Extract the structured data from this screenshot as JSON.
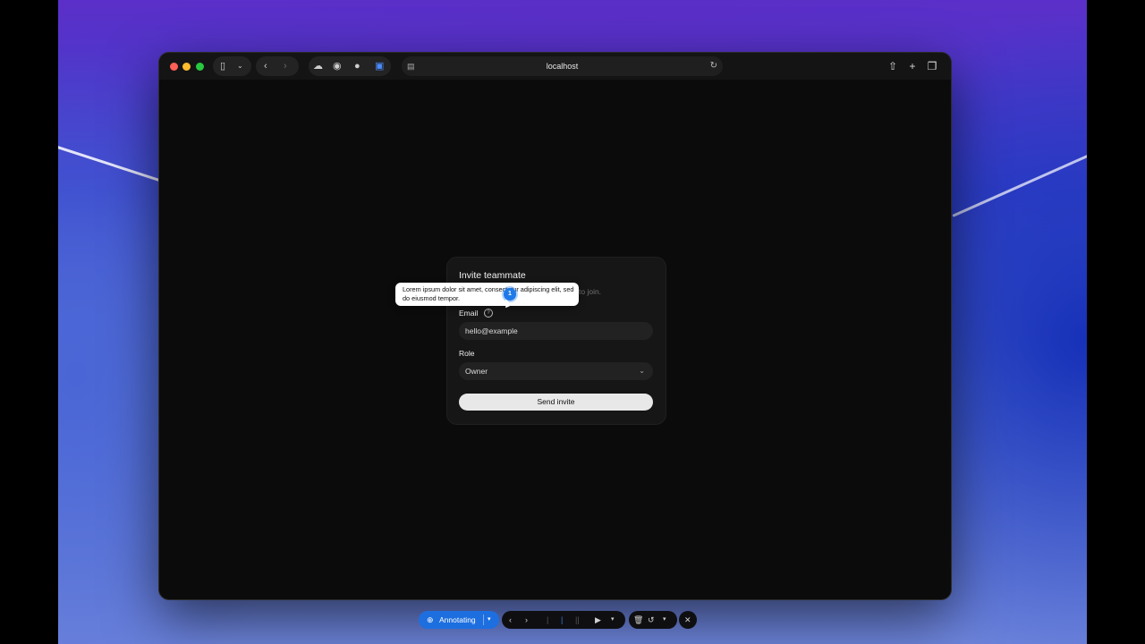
{
  "browser": {
    "url": "localhost",
    "icons": {
      "sidebar": "sidebar-icon",
      "back": "chevron-left-icon",
      "forward": "chevron-right-icon",
      "share": "share-icon",
      "new_tab": "plus-icon",
      "tabs": "tabs-icon",
      "reload": "reload-icon"
    }
  },
  "card": {
    "title": "Invite teammate",
    "description_visible": "to join.",
    "email_label": "Email",
    "email_value": "hello@example",
    "role_label": "Role",
    "role_value": "Owner",
    "submit_label": "Send invite"
  },
  "annotation": {
    "tooltip_text": "Lorem ipsum dolor sit amet, consectetur adipiscing elit, sed do eiusmod tempor.",
    "marker_number": "1"
  },
  "annotator_toolbar": {
    "mode_label": "Annotating"
  },
  "colors": {
    "accent": "#1f7ae8",
    "card_bg": "#161616",
    "button_bg": "#e8e8e8"
  }
}
